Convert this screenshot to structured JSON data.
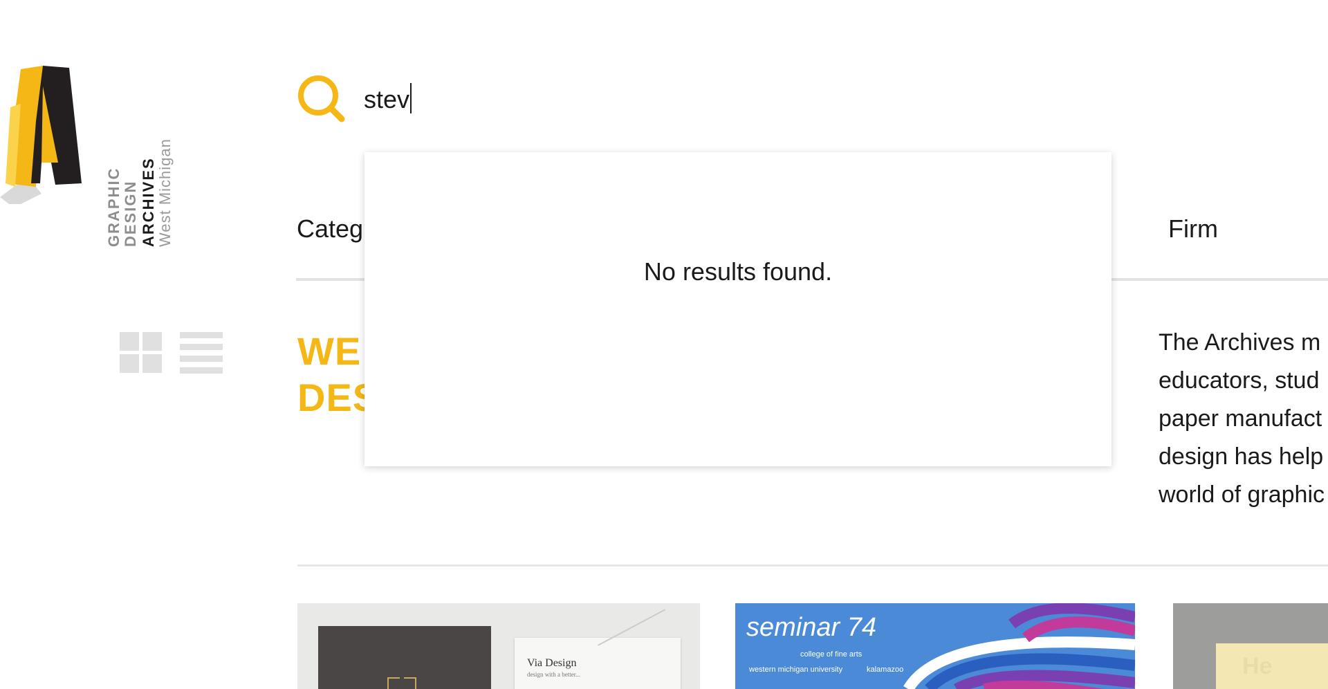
{
  "logo": {
    "mark": "IA",
    "line1": "GRAPHIC",
    "line2": "DESIGN",
    "line3": "ARCHIVES",
    "line4": "West Michigan"
  },
  "search": {
    "value": "stev",
    "placeholder": ""
  },
  "nav": {
    "category_label": "Categ",
    "firm_label": "Firm"
  },
  "hero": {
    "line1": "WE",
    "line2": "DES"
  },
  "intro": {
    "lines": [
      "The Archives m",
      "educators, stud",
      "paper manufact",
      "design has help",
      "world of graphic"
    ]
  },
  "dropdown": {
    "message": "No results found."
  },
  "thumbnails": {
    "thumb1": {
      "booklet_title": "Via Design",
      "booklet_sub": "design with a better..."
    },
    "thumb2": {
      "title": "seminar 74",
      "subtitle": "college of fine arts",
      "footer_left": "western michigan university",
      "footer_right": "kalamazoo"
    },
    "thumb3": {
      "text": "He"
    }
  },
  "colors": {
    "accent": "#f5b716",
    "rule": "#e2e2e2",
    "icon_gray": "#e0e0e0"
  }
}
